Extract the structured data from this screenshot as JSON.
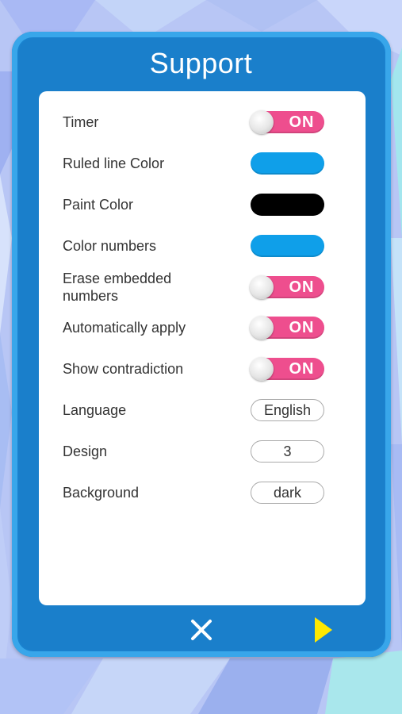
{
  "colors": {
    "panel": "#1a82cf",
    "toggle_on": "#ee4e8e",
    "ruled_line": "#0f9fe9",
    "paint": "#000000",
    "color_numbers": "#0f9fe9",
    "next_arrow": "#ffe800"
  },
  "dialog": {
    "title": "Support"
  },
  "settings": {
    "timer": {
      "label": "Timer",
      "value": "ON"
    },
    "ruled_line_color": {
      "label": "Ruled line Color"
    },
    "paint_color": {
      "label": "Paint Color"
    },
    "color_numbers": {
      "label": "Color numbers"
    },
    "erase_embedded": {
      "label_line1": "Erase embedded",
      "label_line2": "numbers",
      "value": "ON"
    },
    "auto_apply": {
      "label": "Automatically apply",
      "value": "ON"
    },
    "show_contradiction": {
      "label": "Show contradiction",
      "value": "ON"
    },
    "language": {
      "label": "Language",
      "value": "English"
    },
    "design": {
      "label": "Design",
      "value": "3"
    },
    "background": {
      "label": "Background",
      "value": "dark"
    }
  },
  "footer": {
    "close_icon": "close-icon",
    "next_icon": "play-arrow-icon"
  }
}
